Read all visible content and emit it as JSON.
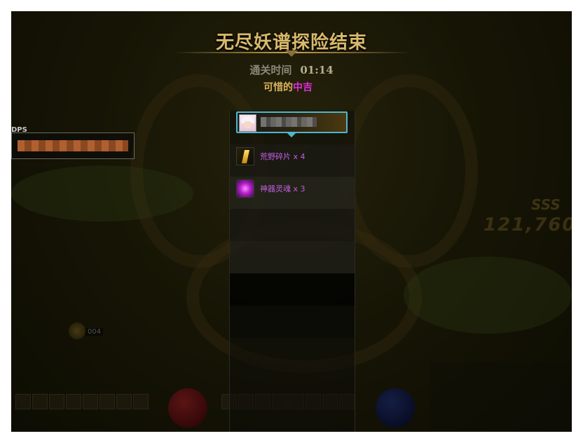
{
  "result": {
    "title": "无尽妖谱探险结束",
    "clear_time_label": "通关时间",
    "clear_time": "01:14",
    "rating_prefix": "可惜的",
    "rating_grade": "中吉"
  },
  "rewards": [
    {
      "icon": "fragment-icon",
      "name": "荒野碎片 x 4"
    },
    {
      "icon": "artifact-soul-icon",
      "name": "神器灵魂 x 3"
    }
  ],
  "dps": {
    "label": "DPS"
  },
  "combat": {
    "rank": "SSS",
    "score": "121,760"
  },
  "hud": {
    "coin_count": "004"
  },
  "colors": {
    "title_gold": "#d9b96a",
    "grade_magenta": "#e02cd8",
    "reward_purple": "#c25fe0",
    "card_border": "#4fb6cf"
  }
}
